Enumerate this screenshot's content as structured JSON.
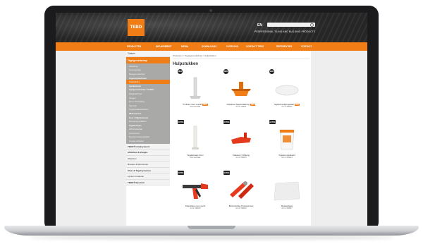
{
  "header": {
    "logo_text": "TEBO",
    "language_label": "EN",
    "search_placeholder": "",
    "tagline": "PROFESSIONAL TILING AND BUILDING PRODUCTS"
  },
  "nav": [
    "PRODUCTEN",
    "NIEUWSBRIEF",
    "MEDIA",
    "DOWNLOADS",
    "OVER ONS",
    "CONTACT TEBO",
    "REFERENTIES",
    "CONTACT"
  ],
  "sidebar": {
    "top_button": "Zoeken",
    "section_head": "Tegelgereedschap",
    "items": [
      {
        "label": "Afwerking",
        "state": ""
      },
      {
        "label": "Gereedschap",
        "state": ""
      },
      {
        "label": "Meetgereedschap",
        "state": ""
      },
      {
        "label": "Tegelsnijmachines",
        "state": "strong"
      },
      {
        "label": "Hulpstukken",
        "state": "active"
      },
      {
        "label": "Lijmkammen",
        "state": "strong"
      },
      {
        "label": "Lijmgereedschap / Troffels",
        "state": "strong"
      },
      {
        "label": "Zaagmachines",
        "state": ""
      },
      {
        "label": "Voegen",
        "state": ""
      },
      {
        "label": "Kit en Verwerking",
        "state": ""
      },
      {
        "label": "Sponzen",
        "state": ""
      },
      {
        "label": "Tegelnivelleersysteem",
        "state": ""
      },
      {
        "label": "Waterpassen",
        "state": "strong"
      },
      {
        "label": "Boor / Slijpmateriaal",
        "state": "strong"
      },
      {
        "label": "Reinigingsmiddelen",
        "state": ""
      },
      {
        "label": "Tegelkruisjes",
        "state": "strong"
      },
      {
        "label": "Afdekmateriaal",
        "state": ""
      },
      {
        "label": "Accessoires",
        "state": ""
      },
      {
        "label": "Beschermingsmiddelen",
        "state": ""
      },
      {
        "label": "Overige artikelen",
        "state": ""
      }
    ],
    "lower": [
      {
        "label": "TEBO® totaalsysteem",
        "state": "strong"
      },
      {
        "label": "Afdichten & Voegen",
        "state": "strong"
      },
      {
        "label": "Afwerken",
        "state": ""
      },
      {
        "label": "Bouwen & Renoveren",
        "state": ""
      },
      {
        "label": "Vloer & Tegelsystemen",
        "state": "strong"
      },
      {
        "label": "Lijmen & Isoleren",
        "state": ""
      },
      {
        "label": "TEBO® Speciaal",
        "state": "strong"
      }
    ]
  },
  "main": {
    "breadcrumb": "Producten > Tegelgereedschap > Hulpstukken",
    "title": "Hulpstukken",
    "products": [
      {
        "badge": "NEW",
        "name": "Profielen Voor Leveld",
        "new": "NEW",
        "sub": "Niet leverbaar",
        "img": "spike"
      },
      {
        "badge": "NEW",
        "name": "Clipsdoos Tegelnivellering",
        "new": "NEW",
        "sub": "Art.nr: 006011",
        "img": "clips"
      },
      {
        "badge": "NEW",
        "name": "Tegelbevestigingsplaat",
        "new": "NEW",
        "sub": "Art.nr: 006012",
        "img": "disc"
      },
      {
        "badge": "EXTRA",
        "name": "Tegelkruisjes 6mm",
        "new": "",
        "sub": "Niet leverbaar",
        "img": "stick"
      },
      {
        "badge": "EXTRA",
        "name": "Kwiktang / Wigtang",
        "new": "",
        "sub": "Art.nr: 006013",
        "img": "wedge"
      },
      {
        "badge": "EXTRA",
        "name": "Tegelset standaard",
        "new": "",
        "sub": "Art.nr: 006014",
        "img": "bucket"
      },
      {
        "badge": "EXTRA",
        "name": "Kitspuittang voor worst",
        "new": "",
        "sub": "Art.nr: 006015",
        "img": "gun"
      },
      {
        "badge": "EXTRA",
        "name": "Buizensnijder Professioneel",
        "new": "",
        "sub": "Art.nr: 006016",
        "img": "cutter"
      },
      {
        "badge": "",
        "name": "Mosaiektegel",
        "new": "",
        "sub": "Art.nr: 006017",
        "img": "mat"
      }
    ]
  },
  "colors": {
    "accent": "#f07d16",
    "header_bg": "#2a2a2a",
    "sidebar_gray": "#a9aaa8"
  }
}
